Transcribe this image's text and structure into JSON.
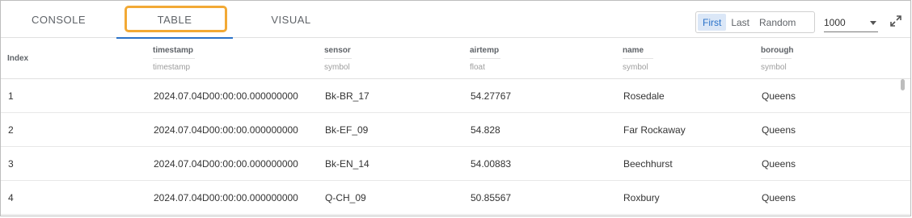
{
  "tabs": {
    "console": "CONSOLE",
    "table": "TABLE",
    "visual": "VISUAL"
  },
  "paging": {
    "first": "First",
    "last": "Last",
    "random": "Random",
    "rows_value": "1000"
  },
  "table": {
    "index_header": "Index",
    "columns": [
      {
        "name": "timestamp",
        "type": "timestamp"
      },
      {
        "name": "sensor",
        "type": "symbol"
      },
      {
        "name": "airtemp",
        "type": "float"
      },
      {
        "name": "name",
        "type": "symbol"
      },
      {
        "name": "borough",
        "type": "symbol"
      }
    ],
    "rows": [
      {
        "index": "1",
        "timestamp": "2024.07.04D00:00:00.000000000",
        "sensor": "Bk-BR_17",
        "airtemp": "54.27767",
        "name": "Rosedale",
        "borough": "Queens"
      },
      {
        "index": "2",
        "timestamp": "2024.07.04D00:00:00.000000000",
        "sensor": "Bk-EF_09",
        "airtemp": "54.828",
        "name": "Far Rockaway",
        "borough": "Queens"
      },
      {
        "index": "3",
        "timestamp": "2024.07.04D00:00:00.000000000",
        "sensor": "Bk-EN_14",
        "airtemp": "54.00883",
        "name": "Beechhurst",
        "borough": "Queens"
      },
      {
        "index": "4",
        "timestamp": "2024.07.04D00:00:00.000000000",
        "sensor": "Q-CH_09",
        "airtemp": "50.85567",
        "name": "Roxbury",
        "borough": "Queens"
      }
    ]
  },
  "colors": {
    "accent": "#2a72c9",
    "highlight": "#f2a935",
    "active_bg": "#dbe7f7"
  },
  "icons": {
    "expand": "expand-icon",
    "dropdown": "chevron-down-icon"
  }
}
